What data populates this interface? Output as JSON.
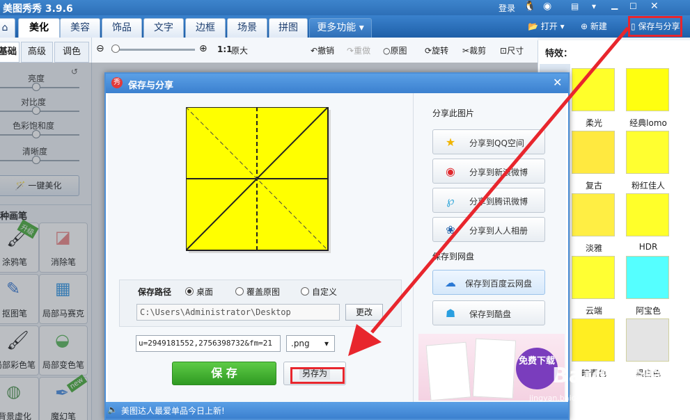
{
  "app": {
    "title": "美图秀秀 3.9.6"
  },
  "titlebar": {
    "login": "登录"
  },
  "tabs": [
    {
      "label": "美化",
      "active": true
    },
    {
      "label": "美容"
    },
    {
      "label": "饰品"
    },
    {
      "label": "文字"
    },
    {
      "label": "边框"
    },
    {
      "label": "场景"
    },
    {
      "label": "拼图"
    },
    {
      "label": "更多功能"
    }
  ],
  "menubar_tools": {
    "open": "打开",
    "new": "新建",
    "save_share": "保存与分享"
  },
  "toolbar": {
    "zoom_ratio": "1:1",
    "original_size": "原大",
    "undo": "撤销",
    "redo": "重做",
    "original": "原图",
    "rotate": "旋转",
    "crop": "裁剪",
    "size": "尺寸"
  },
  "left_panel": {
    "subtabs": [
      "基础",
      "高级",
      "调色"
    ],
    "sliders": [
      {
        "label": "亮度",
        "value": 0.5
      },
      {
        "label": "对比度",
        "value": 0.5
      },
      {
        "label": "色彩饱和度",
        "value": 0.5
      },
      {
        "label": "清晰度",
        "value": 0.5
      }
    ],
    "one_click": "一键美化",
    "brush_header": "种画笔",
    "badge_upgrade": "升级",
    "badge_new": "new",
    "brushes": [
      "涂鸦笔",
      "消除笔",
      "抠图笔",
      "局部马赛克",
      "局部彩色笔",
      "局部变色笔",
      "背景虚化",
      "魔幻笔"
    ]
  },
  "right_panel": {
    "title": "特效：",
    "effects": [
      {
        "label": "柔光",
        "color": "#ffff2a"
      },
      {
        "label": "经典lomo",
        "color": "#ffff10"
      },
      {
        "label": "复古",
        "color": "#ffe940"
      },
      {
        "label": "粉红佳人",
        "color": "#ffff30"
      },
      {
        "label": "淡雅",
        "color": "#ffee44"
      },
      {
        "label": "HDR",
        "color": "#ffff2a"
      },
      {
        "label": "云端",
        "color": "#ffff33"
      },
      {
        "label": "阿宝色",
        "color": "#55ffff"
      },
      {
        "label": "暗青色",
        "color": "#ffee22"
      },
      {
        "label": "黑白色",
        "color": "#e4e4e4"
      }
    ]
  },
  "dialog": {
    "title": "保存与分享",
    "share_header": "分享此图片",
    "share_buttons": [
      "分享到QQ空间",
      "分享到新浪微博",
      "分享到腾讯微博",
      "分享到人人相册"
    ],
    "cloud_header": "保存到网盘",
    "cloud_buttons": [
      "保存到百度云网盘",
      "保存到酷盘"
    ],
    "path_label": "保存路径",
    "path_options": [
      "桌面",
      "覆盖原图",
      "自定义"
    ],
    "path_value": "C:\\Users\\Administrator\\Desktop",
    "change_btn": "更改",
    "filename_value": "u=2949181552,2756398732&fm=21",
    "format_value": ".png",
    "save_btn": "保 存",
    "save_as_btn": "另存为",
    "ad_text": "免费下载",
    "footer_text": "美图达人最爱单品今日上新!"
  },
  "watermark": {
    "main": "Baidu经验",
    "sub": "jingyan.baidu.com"
  },
  "colors": {
    "accent": "#3b80cf",
    "highlight": "#e8262d",
    "preview_fill": "#ffff00",
    "save_green": "#39a92a"
  }
}
